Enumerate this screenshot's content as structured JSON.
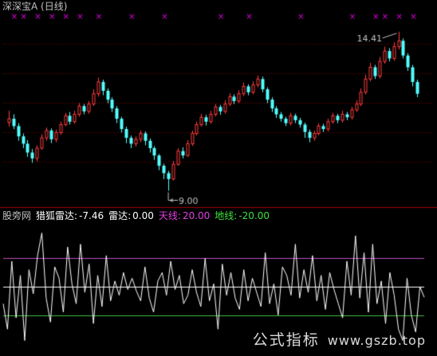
{
  "title": "深深宝A (日线)",
  "indicator": {
    "source": "股旁网",
    "name_label": "猎狐雷达:",
    "name_value": "-7.46",
    "radar_label": "雷达:",
    "radar_value": "0.00",
    "sky_label": "天线:",
    "sky_value": "20.00",
    "ground_label": "地线:",
    "ground_value": "-20.00"
  },
  "watermark": {
    "text": "公式指标",
    "url": "www.gszb.top"
  },
  "colors": {
    "up": "#ff3c3c",
    "down": "#54ffff",
    "osc": "#ffffff",
    "sky": "#c050c0",
    "ground": "#40c040",
    "mid": "#ffffff",
    "marker": "#e000e0",
    "grid": "#800000"
  },
  "chart_data": [
    {
      "type": "candlestick",
      "title": "深深宝A (日线)",
      "ylim": [
        8.5,
        15.0
      ],
      "annotations": [
        {
          "label": "14.41",
          "type": "high"
        },
        {
          "label": "9.00",
          "type": "low"
        }
      ],
      "candles": [
        [
          11.32,
          11.45,
          11.72,
          11.18
        ],
        [
          11.45,
          11.2,
          11.6,
          11.1
        ],
        [
          11.2,
          10.85,
          11.3,
          10.7
        ],
        [
          10.85,
          10.6,
          10.95,
          10.45
        ],
        [
          10.6,
          10.3,
          10.72,
          10.15
        ],
        [
          10.3,
          10.1,
          10.42,
          9.95
        ],
        [
          10.1,
          10.45,
          10.55,
          10.0
        ],
        [
          10.45,
          10.8,
          10.92,
          10.4
        ],
        [
          10.8,
          11.05,
          11.15,
          10.7
        ],
        [
          11.05,
          10.75,
          11.12,
          10.62
        ],
        [
          10.75,
          10.98,
          11.08,
          10.65
        ],
        [
          10.98,
          11.25,
          11.35,
          10.9
        ],
        [
          11.25,
          11.55,
          11.65,
          11.2
        ],
        [
          11.55,
          11.35,
          11.68,
          11.25
        ],
        [
          11.35,
          11.6,
          11.72,
          11.28
        ],
        [
          11.6,
          11.88,
          11.98,
          11.52
        ],
        [
          11.88,
          11.7,
          11.95,
          11.6
        ],
        [
          11.7,
          11.95,
          12.05,
          11.62
        ],
        [
          11.95,
          12.3,
          12.45,
          11.88
        ],
        [
          12.3,
          12.7,
          12.85,
          12.2
        ],
        [
          12.7,
          12.4,
          12.78,
          12.25
        ],
        [
          12.4,
          12.1,
          12.48,
          11.98
        ],
        [
          12.1,
          11.8,
          12.18,
          11.68
        ],
        [
          11.8,
          11.45,
          11.88,
          11.3
        ],
        [
          11.45,
          11.1,
          11.52,
          10.98
        ],
        [
          11.1,
          10.8,
          11.18,
          10.62
        ],
        [
          10.8,
          10.6,
          10.88,
          10.45
        ],
        [
          10.6,
          10.75,
          10.85,
          10.5
        ],
        [
          10.75,
          10.95,
          11.05,
          10.65
        ],
        [
          10.95,
          10.7,
          11.02,
          10.55
        ],
        [
          10.7,
          10.45,
          10.78,
          10.3
        ],
        [
          10.45,
          10.2,
          10.52,
          10.05
        ],
        [
          10.2,
          9.85,
          10.25,
          9.7
        ],
        [
          9.85,
          9.6,
          9.92,
          9.4
        ],
        [
          9.6,
          9.4,
          9.68,
          9.0
        ],
        [
          9.4,
          9.9,
          10.02,
          9.35
        ],
        [
          9.9,
          10.35,
          10.45,
          9.85
        ],
        [
          10.35,
          10.2,
          10.48,
          10.1
        ],
        [
          10.2,
          10.6,
          10.72,
          10.15
        ],
        [
          10.6,
          10.95,
          11.05,
          10.52
        ],
        [
          10.95,
          11.25,
          11.35,
          10.88
        ],
        [
          11.25,
          11.5,
          11.62,
          11.18
        ],
        [
          11.5,
          11.35,
          11.58,
          11.22
        ],
        [
          11.35,
          11.6,
          11.72,
          11.28
        ],
        [
          11.6,
          11.85,
          11.95,
          11.52
        ],
        [
          11.85,
          11.7,
          11.92,
          11.58
        ],
        [
          11.7,
          11.95,
          12.08,
          11.62
        ],
        [
          11.95,
          12.2,
          12.32,
          11.88
        ],
        [
          12.2,
          12.05,
          12.28,
          11.95
        ],
        [
          12.05,
          12.3,
          12.42,
          11.98
        ],
        [
          12.3,
          12.55,
          12.68,
          12.22
        ],
        [
          12.55,
          12.35,
          12.62,
          12.25
        ],
        [
          12.35,
          12.6,
          12.72,
          12.28
        ],
        [
          12.6,
          12.8,
          12.92,
          12.52
        ],
        [
          12.8,
          12.45,
          12.88,
          12.35
        ],
        [
          12.45,
          12.1,
          12.52,
          11.98
        ],
        [
          12.1,
          11.8,
          12.18,
          11.68
        ],
        [
          11.8,
          11.6,
          11.88,
          11.48
        ],
        [
          11.6,
          11.45,
          11.68,
          11.35
        ],
        [
          11.45,
          11.3,
          11.52,
          11.2
        ],
        [
          11.3,
          11.55,
          11.65,
          11.22
        ],
        [
          11.55,
          11.4,
          11.62,
          11.3
        ],
        [
          11.4,
          11.25,
          11.48,
          11.15
        ],
        [
          11.25,
          11.0,
          11.32,
          10.8
        ],
        [
          11.0,
          10.8,
          11.08,
          10.65
        ],
        [
          10.8,
          10.95,
          11.05,
          10.7
        ],
        [
          10.95,
          11.2,
          11.3,
          10.88
        ],
        [
          11.2,
          11.1,
          11.28,
          11.0
        ],
        [
          11.1,
          11.35,
          11.45,
          11.02
        ],
        [
          11.35,
          11.55,
          11.65,
          11.28
        ],
        [
          11.55,
          11.4,
          11.62,
          11.3
        ],
        [
          11.4,
          11.6,
          11.72,
          11.32
        ],
        [
          11.6,
          11.5,
          11.68,
          11.4
        ],
        [
          11.5,
          11.75,
          11.85,
          11.42
        ],
        [
          11.75,
          11.95,
          12.08,
          11.68
        ],
        [
          11.95,
          12.35,
          12.48,
          11.88
        ],
        [
          12.35,
          12.8,
          12.95,
          12.28
        ],
        [
          12.8,
          13.2,
          13.35,
          12.72
        ],
        [
          13.2,
          12.9,
          13.28,
          12.8
        ],
        [
          12.9,
          13.4,
          13.55,
          12.82
        ],
        [
          13.4,
          13.75,
          13.9,
          13.32
        ],
        [
          13.75,
          13.5,
          13.85,
          13.4
        ],
        [
          13.5,
          13.9,
          14.05,
          13.42
        ],
        [
          13.9,
          14.1,
          14.41,
          13.8
        ],
        [
          14.1,
          13.6,
          14.18,
          13.5
        ],
        [
          13.6,
          13.2,
          13.68,
          13.08
        ],
        [
          13.2,
          12.7,
          13.28,
          12.55
        ],
        [
          12.7,
          12.3,
          12.78,
          12.18
        ]
      ],
      "markers": [
        1,
        3,
        6,
        9,
        12,
        15,
        19,
        26,
        33,
        45,
        51,
        62,
        73,
        78,
        80,
        83,
        86
      ]
    },
    {
      "type": "line",
      "title": "猎狐雷达",
      "ylim": [
        -45,
        45
      ],
      "reference_lines": [
        {
          "name": "天线",
          "value": 20
        },
        {
          "name": "雷达",
          "value": 0
        },
        {
          "name": "地线",
          "value": -20
        }
      ],
      "series": [
        {
          "name": "猎狐雷达",
          "values": [
            -12,
            -30,
            18,
            -22,
            8,
            -38,
            12,
            -5,
            22,
            38,
            -8,
            -25,
            14,
            6,
            -18,
            28,
            2,
            -12,
            30,
            -4,
            16,
            -26,
            8,
            -14,
            22,
            -10,
            4,
            -6,
            10,
            -2,
            6,
            -3,
            -10,
            14,
            -8,
            -18,
            4,
            10,
            -6,
            18,
            -2,
            8,
            -12,
            -6,
            12,
            -4,
            -14,
            20,
            -10,
            2,
            -30,
            16,
            -6,
            10,
            -8,
            -16,
            12,
            -10,
            6,
            -4,
            -14,
            24,
            -12,
            2,
            -20,
            14,
            8,
            -6,
            30,
            -8,
            12,
            -4,
            22,
            -10,
            8,
            -16,
            10,
            -2,
            -12,
            -22,
            18,
            -6,
            36,
            -8,
            24,
            -18,
            30,
            -12,
            4,
            -26,
            10,
            -6,
            -30,
            -38,
            6,
            -20,
            -32,
            0,
            -7.46
          ]
        }
      ]
    }
  ]
}
